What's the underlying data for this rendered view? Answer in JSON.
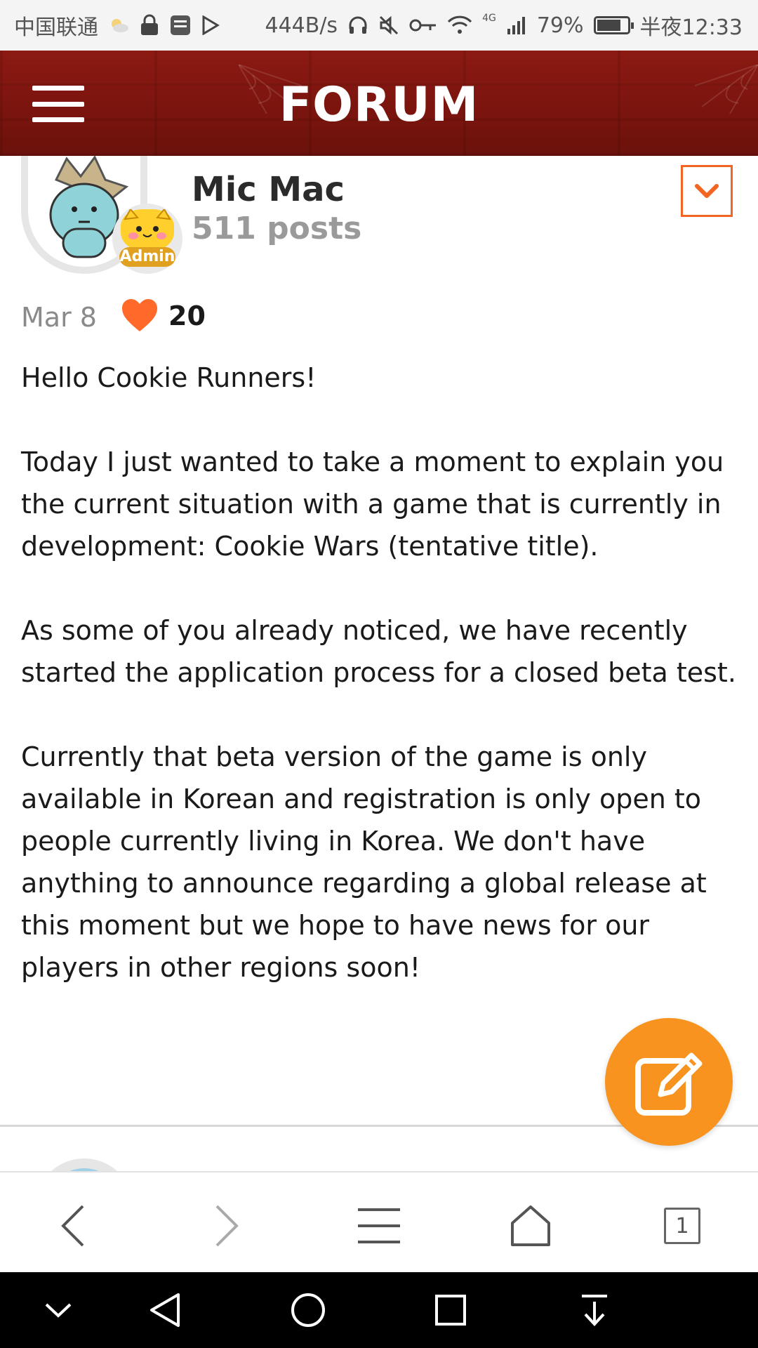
{
  "status_bar": {
    "carrier": "中国联通",
    "net_speed": "444B/s",
    "network_type": "4G",
    "battery_percent": "79%",
    "battery_level": 0.79,
    "time": "半夜12:33"
  },
  "header": {
    "title": "FORUM",
    "menu_icon": "hamburger-menu-icon",
    "background_color": "#7a140e"
  },
  "post": {
    "author": {
      "name": "Mic Mac",
      "post_count": "511 posts",
      "role_badge": "Admin"
    },
    "date": "Mar 8",
    "likes": "20",
    "accent_color": "#f26522",
    "body": [
      "Hello Cookie Runners!",
      "Today I just wanted to take a moment to explain you the current situation with a game that is currently in development: Cookie Wars (tentative title).",
      "As some of you already noticed, we have recently started the application process for a closed beta test.",
      "Currently that beta version of the game is only available in Korean and registration is only open to people currently living in Korea. We don't have anything to announce regarding a global release at this moment but we hope to have news for our players in other regions soon!"
    ]
  },
  "fab": {
    "icon": "edit-icon",
    "color": "#f7931e"
  },
  "browser_nav": {
    "items": [
      "back-icon",
      "forward-icon",
      "menu-icon",
      "home-icon",
      "tabs-icon"
    ],
    "tab_count": "1"
  },
  "system_nav": {
    "items": [
      "collapse-icon",
      "back-icon",
      "home-icon",
      "recents-icon",
      "notification-pull-icon"
    ]
  }
}
